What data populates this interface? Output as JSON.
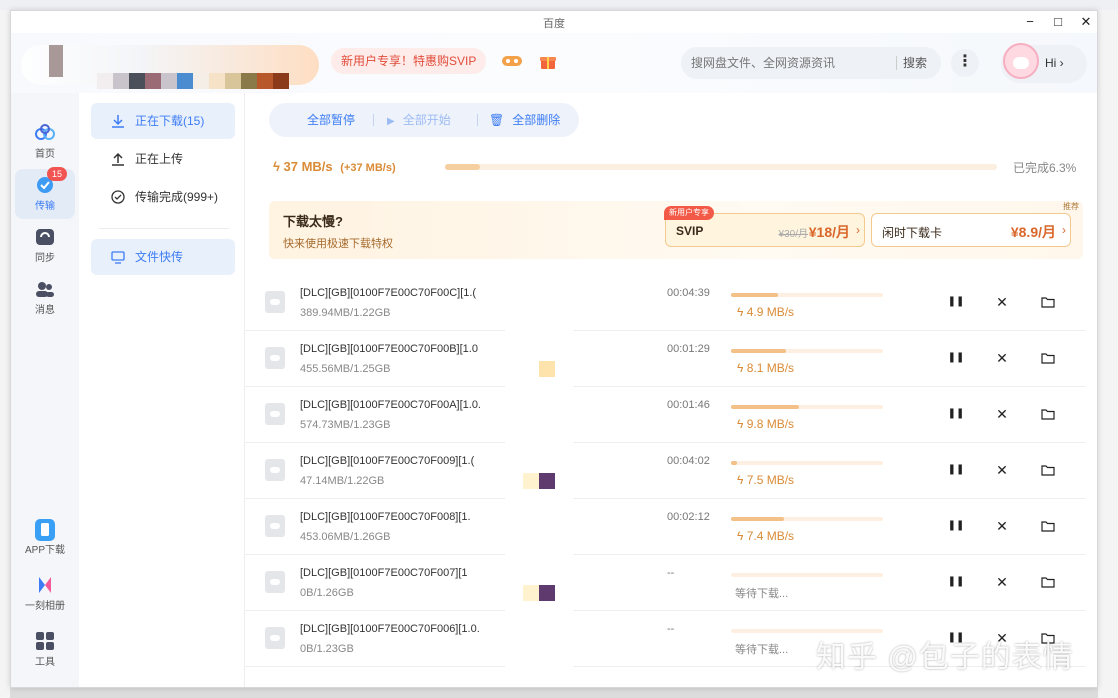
{
  "window": {
    "title": "百度",
    "controls": {
      "minimize": "−",
      "maximize": "□",
      "close": "✕"
    }
  },
  "header": {
    "promo": "新用户专享！特惠购SVIP",
    "search_placeholder": "搜网盘文件、全网资源资讯",
    "search_button": "搜索",
    "more": "⋮",
    "user_greeting": "Hi ›"
  },
  "nav": [
    {
      "label": "首页",
      "icon": "home-icon"
    },
    {
      "label": "传输",
      "icon": "transfer-icon",
      "badge": "15",
      "active": true
    },
    {
      "label": "同步",
      "icon": "sync-icon"
    },
    {
      "label": "消息",
      "icon": "message-icon"
    },
    {
      "label": "APP下载",
      "icon": "phone-icon"
    },
    {
      "label": "一刻相册",
      "icon": "album-icon"
    },
    {
      "label": "工具",
      "icon": "tools-icon"
    }
  ],
  "subnav": [
    {
      "label": "正在下载(15)",
      "icon": "download-icon",
      "active": true
    },
    {
      "label": "正在上传",
      "icon": "upload-icon"
    },
    {
      "label": "传输完成(999+)",
      "icon": "check-circle-icon"
    },
    {
      "label": "文件快传",
      "icon": "monitor-icon",
      "active": true
    }
  ],
  "toolbar": {
    "pause_all": "全部暂停",
    "start_all": "全部开始",
    "delete_all": "全部删除"
  },
  "speed": {
    "current": "37 MB/s",
    "boost": "(+37 MB/s)",
    "completed": "已完成6.3%",
    "progress": 0.063
  },
  "slow_banner": {
    "title": "下载太慢?",
    "subtitle": "快来使用极速下载特权",
    "corner": "推荐",
    "svip": {
      "tag": "新用户专享",
      "name": "SVIP",
      "old_price": "¥30/月",
      "price": "¥18/月",
      "arrow": "›"
    },
    "idle": {
      "name": "闲时下载卡",
      "price": "¥8.9/月",
      "arrow": "›"
    }
  },
  "downloads": [
    {
      "name": "[DLC][GB][0100F7E00C70F00C][1.(",
      "size": "389.94MB/1.22GB",
      "remaining": "00:04:39",
      "speed": "4.9 MB/s",
      "progress": 0.31
    },
    {
      "name": "[DLC][GB][0100F7E00C70F00B][1.0",
      "size": "455.56MB/1.25GB",
      "remaining": "00:01:29",
      "speed": "8.1 MB/s",
      "progress": 0.36
    },
    {
      "name": "[DLC][GB][0100F7E00C70F00A][1.0.",
      "size": "574.73MB/1.23GB",
      "remaining": "00:01:46",
      "speed": "9.8 MB/s",
      "progress": 0.45
    },
    {
      "name": "[DLC][GB][0100F7E00C70F009][1.(",
      "size": "47.14MB/1.22GB",
      "remaining": "00:04:02",
      "speed": "7.5 MB/s",
      "progress": 0.04
    },
    {
      "name": "[DLC][GB][0100F7E00C70F008][1.",
      "size": "453.06MB/1.26GB",
      "remaining": "00:02:12",
      "speed": "7.4 MB/s",
      "progress": 0.35
    },
    {
      "name": "[DLC][GB][0100F7E00C70F007][1",
      "size": "0B/1.26GB",
      "remaining": "--",
      "waiting": "等待下载...",
      "progress": 0
    },
    {
      "name": "[DLC][GB][0100F7E00C70F006][1.0.",
      "size": "0B/1.23GB",
      "remaining": "--",
      "waiting": "等待下载...",
      "progress": 0
    }
  ],
  "row_actions": {
    "pause": "❚❚",
    "remove": "✕",
    "folder": "folder-icon"
  },
  "watermark": "知乎 @包子的表情",
  "colors": {
    "accent": "#3d7cf4",
    "speed": "#d98b36",
    "badge": "#f25452",
    "promo": "#e24c3a"
  }
}
